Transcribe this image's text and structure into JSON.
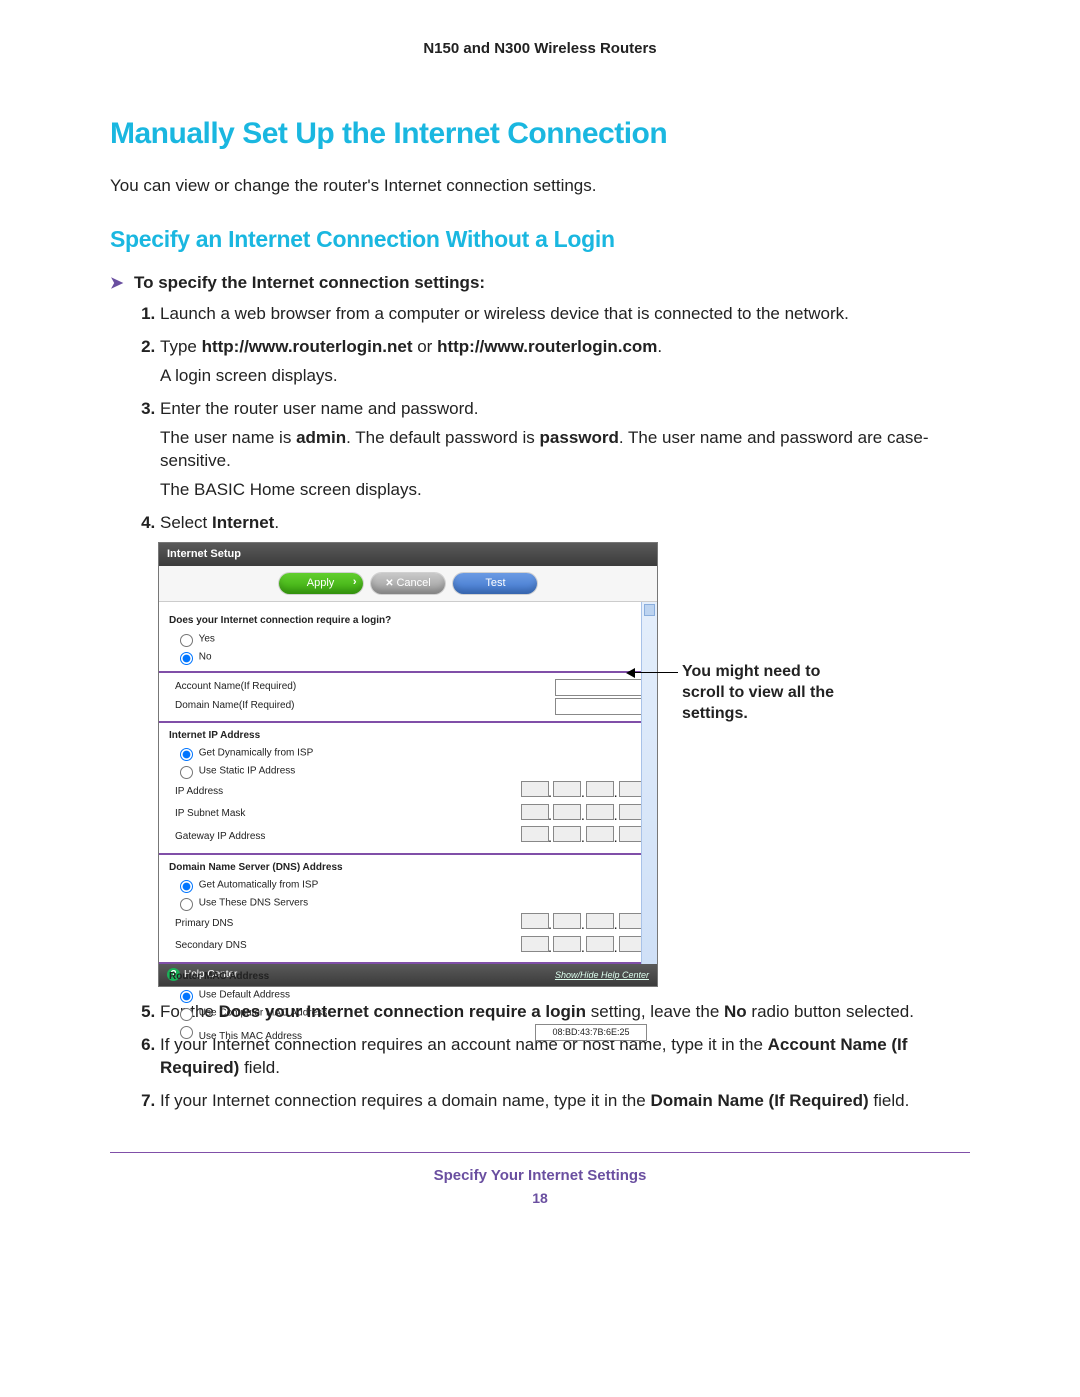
{
  "header": {
    "title": "N150 and N300 Wireless Routers"
  },
  "h1": "Manually Set Up the Internet Connection",
  "intro": "You can view or change the router's Internet connection settings.",
  "h2": "Specify an Internet Connection Without a Login",
  "proc_arrow": "➤",
  "proc_title": "To specify the Internet connection settings:",
  "steps": {
    "s1": "Launch a web browser from a computer or wireless device that is connected to the network.",
    "s2_pre": "Type ",
    "s2_b1": "http://www.routerlogin.net",
    "s2_mid": " or ",
    "s2_b2": "http://www.routerlogin.com",
    "s2_post": ".",
    "s2_p2": "A login screen displays.",
    "s3": "Enter the router user name and password.",
    "s3_p2a": "The user name is ",
    "s3_p2b": "admin",
    "s3_p2c": ". The default password is ",
    "s3_p2d": "password",
    "s3_p2e": ". The user name and password are case-sensitive.",
    "s3_p3": "The BASIC Home screen displays.",
    "s4_pre": "Select ",
    "s4_b": "Internet",
    "s4_post": ".",
    "s5_pre": "For the ",
    "s5_b1": "Does your Internet connection require a login",
    "s5_mid": " setting, leave the ",
    "s5_b2": "No",
    "s5_post": " radio button selected.",
    "s6_pre": "If your Internet connection requires an account name or host name, type it in the ",
    "s6_b": "Account Name (If Required)",
    "s6_post": " field.",
    "s7_pre": "If your Internet connection requires a domain name, type it in the ",
    "s7_b": "Domain Name (If Required)",
    "s7_post": " field."
  },
  "screenshot": {
    "title": "Internet Setup",
    "buttons": {
      "apply": "Apply",
      "cancel": "Cancel",
      "test": "Test"
    },
    "q_login": "Does your Internet connection require a login?",
    "yes": "Yes",
    "no": "No",
    "acct": "Account Name(If Required)",
    "domain": "Domain Name(If Required)",
    "sec_ip": "Internet IP Address",
    "ip_dyn": "Get Dynamically from ISP",
    "ip_static": "Use Static IP Address",
    "ip_addr": "IP Address",
    "ip_mask": "IP Subnet Mask",
    "ip_gw": "Gateway IP Address",
    "sec_dns": "Domain Name Server (DNS) Address",
    "dns_auto": "Get Automatically from ISP",
    "dns_these": "Use These DNS Servers",
    "dns_pri": "Primary DNS",
    "dns_sec": "Secondary DNS",
    "sec_mac": "Router MAC Address",
    "mac_def": "Use Default Address",
    "mac_comp": "Use Computer MAC Address",
    "mac_this": "Use This MAC Address",
    "mac_value": "08:BD:43:7B:6E:25",
    "help": "Help Center",
    "showhide": "Show/Hide Help Center"
  },
  "callout": "You might need to scroll to view all the settings.",
  "footer": {
    "chapter": "Specify Your Internet Settings",
    "page": "18"
  }
}
